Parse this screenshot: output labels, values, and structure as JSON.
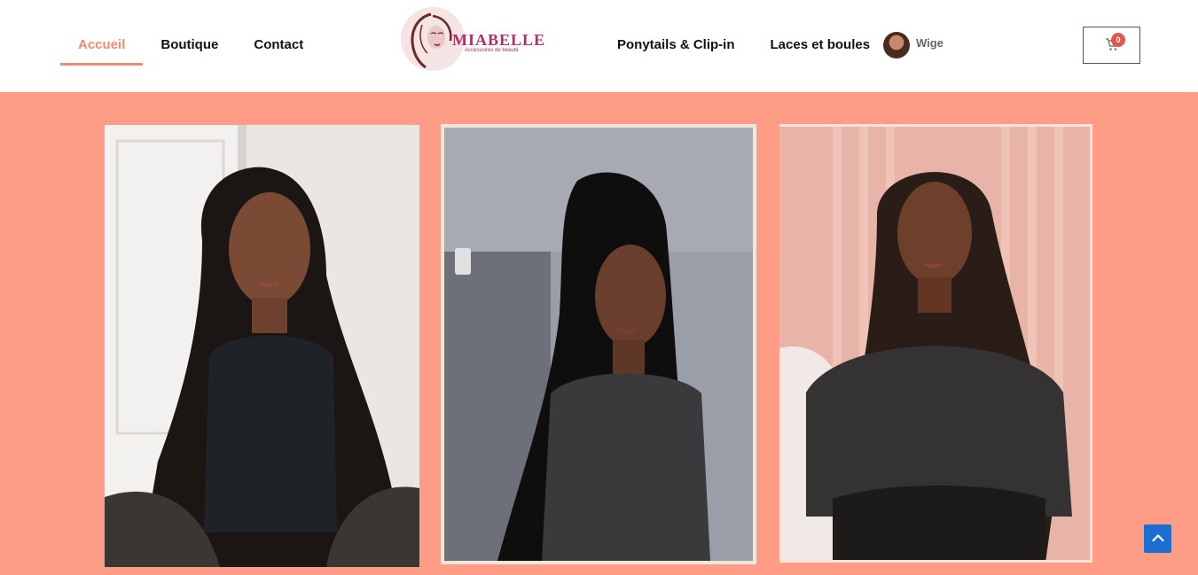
{
  "nav": {
    "left_items": [
      {
        "label": "Accueil",
        "active": true
      },
      {
        "label": "Boutique",
        "active": false
      },
      {
        "label": "Contact",
        "active": false
      }
    ],
    "right_items": [
      {
        "label": "Ponytails & Clip-in"
      },
      {
        "label": "Laces et boules"
      }
    ]
  },
  "logo": {
    "name": "MIABELLE",
    "tagline": "Accessoires de beauté"
  },
  "user": {
    "name": "Wige"
  },
  "cart": {
    "count": "0",
    "icon": "cart-icon"
  },
  "gallery": {
    "background": "#ff9c85",
    "photos": [
      {
        "description": "Model with long wavy black hair wearing a black crop top"
      },
      {
        "description": "Model with long straight black hair wearing a grey tank top"
      },
      {
        "description": "Model with long body-wave dark hair wearing a black long-sleeve top"
      }
    ]
  },
  "scroll_top": {
    "icon": "chevron-up-icon"
  },
  "colors": {
    "accent": "#ef8b74",
    "salmon": "#ff9c85",
    "brand": "#b03063",
    "badge": "#e4564d",
    "scroll_button": "#1a6fd1"
  }
}
